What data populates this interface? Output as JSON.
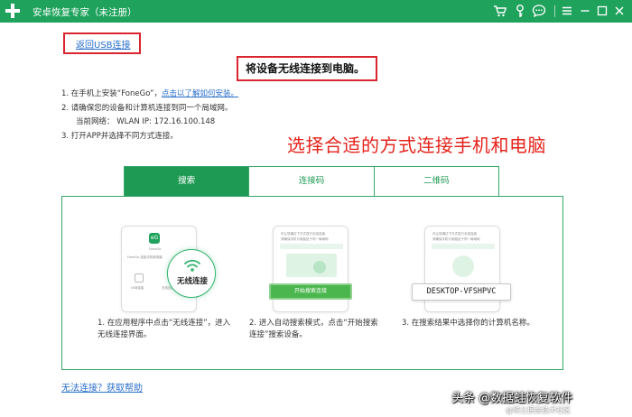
{
  "window": {
    "title": "安卓恢复专家（未注册）",
    "brand_color": "#1fa35c",
    "icons": [
      "cart-icon",
      "key-icon",
      "feedback-icon",
      "menu-icon",
      "minimize-icon",
      "maximize-icon",
      "close-icon"
    ]
  },
  "nav": {
    "back_label": "返回USB连接"
  },
  "main": {
    "heading": "将设备无线连接到电脑。",
    "steps": {
      "s1_prefix": "1.  在手机上安装“FoneGo”，",
      "s1_link": "点击以了解如何安装。",
      "s2": "2.  请确保您的设备和计算机连接到同一个局域网。",
      "network": "当前网络：   WLAN     IP:  172.16.100.148",
      "s3": "3.  打开APP并选择不同方式连接。"
    },
    "annotation": "选择合适的方式连接手机和电脑",
    "annotation_color": "#e5231b"
  },
  "tabs": [
    {
      "label": "搜索",
      "active": true
    },
    {
      "label": "连接码",
      "active": false
    },
    {
      "label": "二维码",
      "active": false
    }
  ],
  "panel": {
    "card1": {
      "app_name": "FoneGo",
      "text_a": "FoneGo 连接手机和电脑",
      "text_b": "USB连接",
      "text_c": "无线连接"
    },
    "wifi_label": "无线连接",
    "card2": {
      "caption": "可让您通过下方式进行无线连接",
      "sub": "请确保手机与电脑处于同一局域网"
    },
    "start_button": "开始搜索连接",
    "card3": {
      "caption": "可让您通过下方式进行无线连接",
      "sub": "请确保手机与电脑处于同一局域网"
    },
    "device_name": "DESKTOP-VFSHPVC",
    "desc1": "1.  在应用程序中点击“无线连接”，进入无线连接界面。",
    "desc2": "2.  进入自动搜索模式，点击“开始搜索连接”搜索设备。",
    "desc3": "3.  在搜索结果中选择你的计算机名称。"
  },
  "footer": {
    "help_link": "无法连接？获取帮助"
  },
  "watermark": {
    "main": "头条 @数据蛙恢复软件",
    "sub": "@稀土掘金技术社区"
  }
}
